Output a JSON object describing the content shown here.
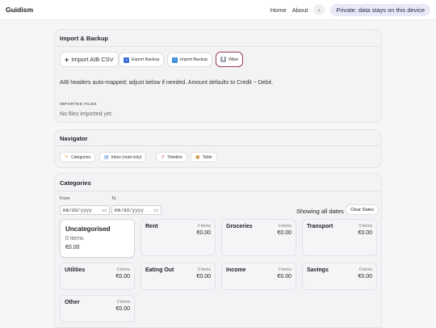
{
  "header": {
    "brand": "Guidism",
    "nav": [
      "Home",
      "About"
    ],
    "back_glyph": "‹",
    "privacy": "Private: data stays on this device"
  },
  "import_backup": {
    "title": "Import & Backup",
    "buttons": {
      "import_csv": "Import AIB CSV",
      "export": "Export Backup",
      "import_backup": "Import Backup",
      "wipe": "Wipe"
    },
    "note": "AIB headers auto-mapped; adjust below if needed. Amount defaults to Credit − Debit.",
    "imported_label": "IMPORTED FILES",
    "imported_empty": "No files imported yet."
  },
  "navigator": {
    "title": "Navigator",
    "items": [
      "Categories",
      "Inbox (read-only)",
      "Timeline",
      "Table"
    ]
  },
  "categories": {
    "title": "Categories",
    "from_label": "From",
    "to_label": "To",
    "from_placeholder": "mm/dd/yyyy",
    "to_placeholder": "mm/dd/yyyy",
    "showing": "Showing all dates",
    "clear_label": "Clear Dates",
    "cards": [
      {
        "name": "Uncategorised",
        "items": "0 items",
        "amount": "€0.00"
      },
      {
        "name": "Rent",
        "items": "0 items",
        "amount": "€0.00"
      },
      {
        "name": "Groceries",
        "items": "0 items",
        "amount": "€0.00"
      },
      {
        "name": "Transport",
        "items": "0 items",
        "amount": "€0.00"
      },
      {
        "name": "Utilities",
        "items": "0 items",
        "amount": "€0.00"
      },
      {
        "name": "Eating Out",
        "items": "0 items",
        "amount": "€0.00"
      },
      {
        "name": "Income",
        "items": "0 items",
        "amount": "€0.00"
      },
      {
        "name": "Savings",
        "items": "0 items",
        "amount": "€0.00"
      },
      {
        "name": "Other",
        "items": "0 items",
        "amount": "€0.00"
      }
    ]
  },
  "colors": {
    "accent_pill": "#e9e9f7",
    "wipe_border": "#9c3b54",
    "export_icon": "#3b6fd6",
    "import_icon": "#3b8fd6"
  },
  "icons": {
    "plus": "plus-icon",
    "export": "export-icon",
    "import": "import-icon",
    "wipe": "trash-icon",
    "categories": "tag-icon",
    "inbox": "inbox-icon",
    "timeline": "chart-icon",
    "table": "clipboard-icon",
    "calendar": "calendar-icon"
  }
}
